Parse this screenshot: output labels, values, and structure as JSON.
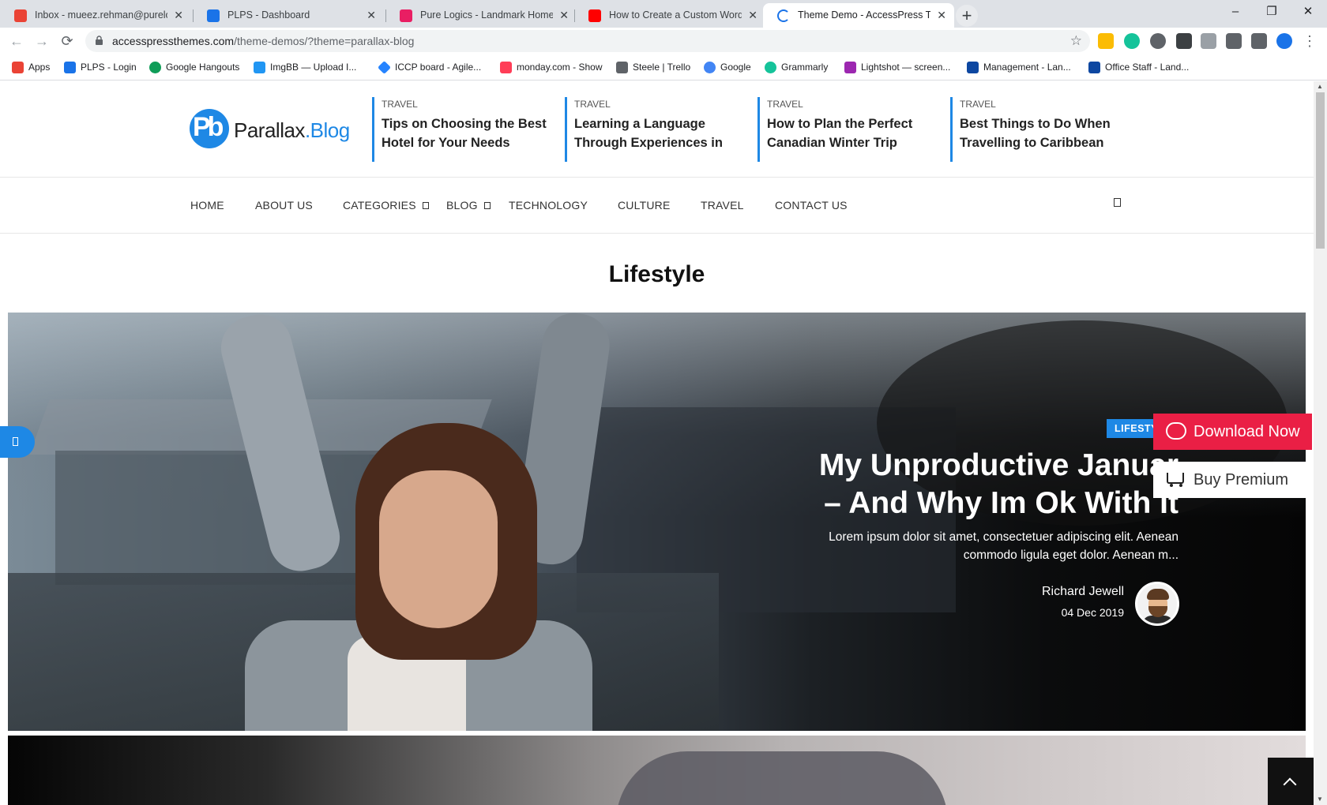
{
  "browser": {
    "tabs": [
      {
        "title": "Inbox - mueez.rehman@purelogi",
        "favicon_color": "#ea4335",
        "close": "✕"
      },
      {
        "title": "PLPS - Dashboard",
        "favicon_color": "#1a73e8",
        "close": "✕"
      },
      {
        "title": "Pure Logics - Landmark Homepa",
        "favicon_color": "#e91e63",
        "close": "✕"
      },
      {
        "title": "How to Create a Custom WordPr",
        "favicon_color": "#ff0000",
        "close": "✕"
      },
      {
        "title": "Theme Demo - AccessPress Them",
        "favicon_color": "#1a73e8",
        "close": "✕"
      }
    ],
    "new_tab": "+",
    "window_controls": {
      "minimize": "–",
      "restore": "❐",
      "close": "✕"
    },
    "nav": {
      "back": "←",
      "forward": "→",
      "reload": "⟳"
    },
    "url_host": "accesspressthemes.com",
    "url_path": "/theme-demos/?theme=parallax-blog",
    "bookmark_star": "☆",
    "bookmarks": [
      {
        "label": "Apps",
        "color": "#ea4335"
      },
      {
        "label": "PLPS - Login",
        "color": "#1a73e8"
      },
      {
        "label": "Google Hangouts",
        "color": "#0f9d58"
      },
      {
        "label": "ImgBB — Upload I...",
        "color": "#2196f3"
      },
      {
        "label": "ICCP board - Agile...",
        "color": "#2684ff"
      },
      {
        "label": "monday.com - Show",
        "color": "#ff3d57"
      },
      {
        "label": "Steele | Trello",
        "color": "#5f6368"
      },
      {
        "label": "Google",
        "color": "#4285f4"
      },
      {
        "label": "Grammarly",
        "color": "#15c39a"
      },
      {
        "label": "Lightshot — screen...",
        "color": "#9c27b0"
      },
      {
        "label": "Management - Lan...",
        "color": "#0d47a1"
      },
      {
        "label": "Office Staff - Land...",
        "color": "#0d47a1"
      }
    ]
  },
  "site": {
    "logo_mark": "Pb",
    "logo_name": "Parallax",
    "logo_suffix": ".Blog",
    "ticker": [
      {
        "category": "TRAVEL",
        "title": "Tips on Choosing the Best Hotel for Your Needs"
      },
      {
        "category": "TRAVEL",
        "title": "Learning a Language Through Experiences in"
      },
      {
        "category": "TRAVEL",
        "title": "How to Plan the Perfect Canadian Winter Trip"
      },
      {
        "category": "TRAVEL",
        "title": "Best Things to Do When Travelling to Caribbean"
      }
    ],
    "menu": [
      "HOME",
      "ABOUT US",
      "CATEGORIES",
      "BLOG",
      "TECHNOLOGY",
      "CULTURE",
      "TRAVEL",
      "CONTACT US"
    ],
    "section_title": "Lifestyle",
    "featured": {
      "category": "LIFESTYLE",
      "title_line1": "My Unproductive Januar",
      "title_line2": "– And Why Im Ok With It",
      "excerpt": "Lorem ipsum dolor sit amet, consectetuer adipiscing elit. Aenean commodo ligula eget dolor. Aenean m...",
      "author": "Richard Jewell",
      "date": "04 Dec 2019"
    },
    "download_label": "Download Now",
    "premium_label": "Buy Premium",
    "accent": "#1e88e5",
    "download_color": "#ea1f45"
  }
}
